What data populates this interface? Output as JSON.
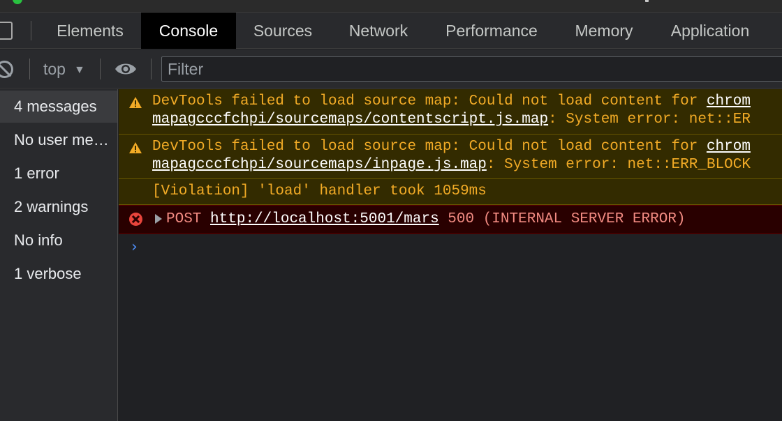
{
  "devtools": {
    "tabs": [
      "Elements",
      "Console",
      "Sources",
      "Network",
      "Performance",
      "Memory",
      "Application"
    ],
    "active_tab": "Console"
  },
  "toolbar": {
    "context": "top",
    "filter_placeholder": "Filter"
  },
  "sidebar": {
    "items": [
      "4 messages",
      "No user me…",
      "1 error",
      "2 warnings",
      "No info",
      "1 verbose"
    ],
    "selected": "4 messages"
  },
  "console": {
    "messages": [
      {
        "level": "warning",
        "line1_prefix": "DevTools failed to load source map: Could not load content for ",
        "line1_link": "chrom",
        "line2_link": "mapagcccfchpi/sourcemaps/contentscript.js.map",
        "line2_suffix": ": System error: net::ER"
      },
      {
        "level": "warning",
        "line1_prefix": "DevTools failed to load source map: Could not load content for ",
        "line1_link": "chrom",
        "line2_link": "mapagcccfchpi/sourcemaps/inpage.js.map",
        "line2_suffix": ": System error: net::ERR_BLOCK"
      },
      {
        "level": "violation",
        "text": "[Violation] 'load' handler took 1059ms"
      },
      {
        "level": "error",
        "method": "POST",
        "url": "http://localhost:5001/mars",
        "status": "500 (INTERNAL SERVER ERROR)"
      }
    ],
    "prompt": "›"
  },
  "colors": {
    "warning_text": "#f2ab26",
    "warning_bg": "#332b00",
    "error_text": "#f28b82",
    "error_bg": "#290000",
    "prompt": "#4e8ef7"
  }
}
